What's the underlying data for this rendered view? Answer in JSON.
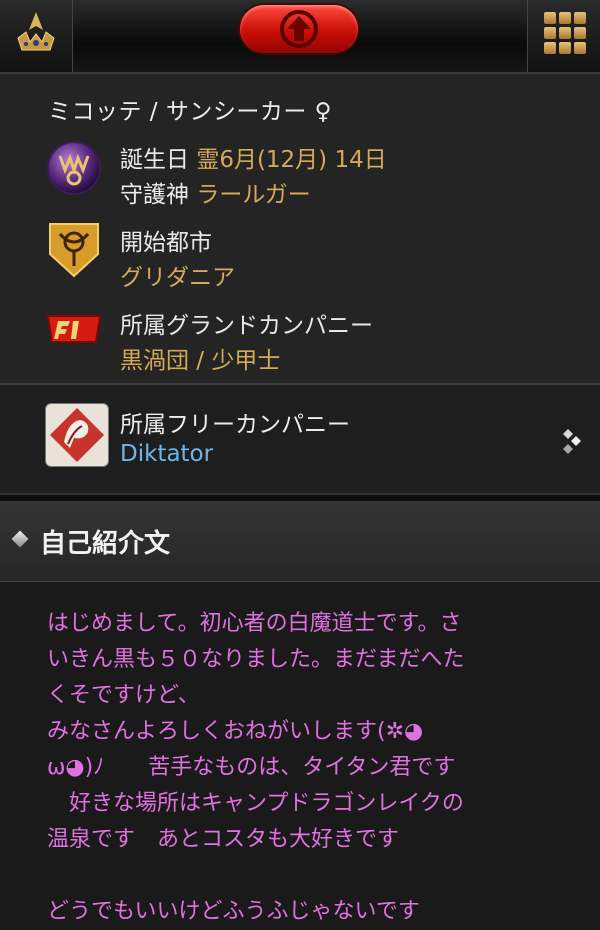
{
  "profile": {
    "race_line": "ミコッテ / サンシーカー ♀",
    "birthday_label": "誕生日",
    "birthday_value": "霊6月(12月) 14日",
    "guardian_label": "守護神",
    "guardian_value": "ラールガー",
    "city_label": "開始都市",
    "city_value": "グリダニア",
    "gc_label": "所属グランドカンパニー",
    "gc_value": "黒渦団 / 少甲士"
  },
  "free_company": {
    "label": "所属フリーカンパニー",
    "name": "Diktator"
  },
  "intro": {
    "title": "自己紹介文",
    "text": "はじめまして。初心者の白魔道士です。さ\nいきん黒も５０なりました。まだまだへた\nくそですけど、\nみなさんよろしくおねがいします(✲◕\nω◕)ﾉ　　苦手なものは、タイタン君です\n　好きな場所はキャンプドラゴンレイクの\n温泉です　あとコスタも大好きです\n\nどうでもいいけどふうふじゃないです"
  },
  "colors": {
    "label": "#ececec",
    "value_gold": "#d4aa55",
    "fc_name_blue": "#6fb6e8",
    "intro_pink": "#e071e0"
  },
  "icons": {
    "top_left": "crown-icon",
    "top_center": "home-up-icon",
    "top_right": "grid-menu-icon",
    "guardian": "guardian-deity-icon",
    "city": "city-emblem-icon",
    "gc": "grand-company-icon",
    "fc": "free-company-emblem-icon",
    "fc_nav": "diamond-arrows-icon",
    "section": "diamond-bullet-icon"
  }
}
